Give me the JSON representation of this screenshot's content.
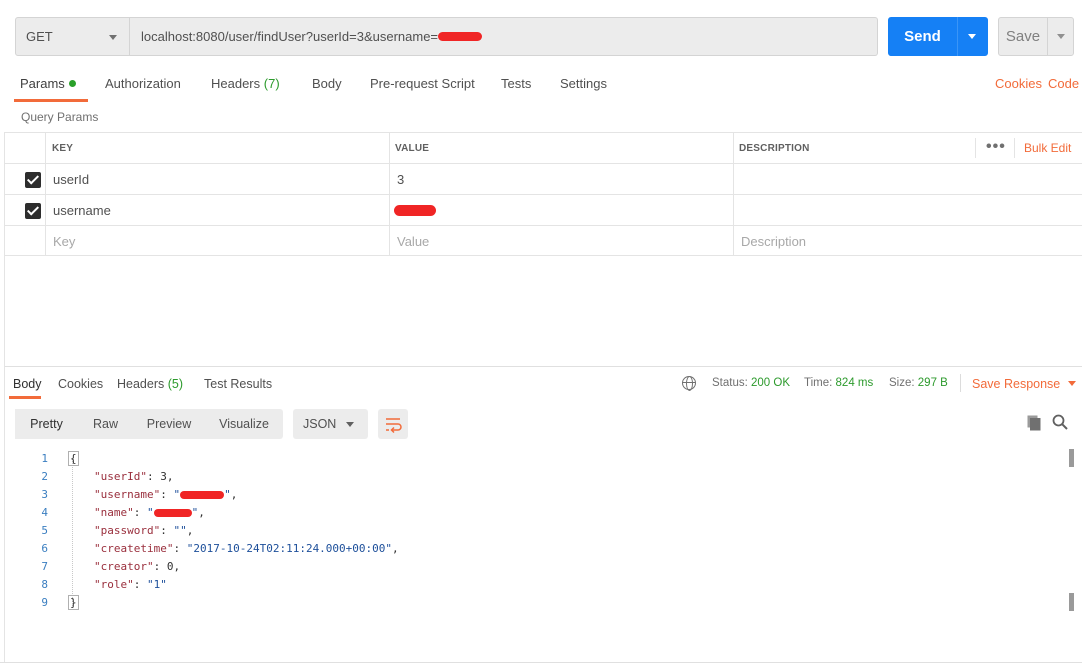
{
  "request": {
    "method": "GET",
    "url": "localhost:8080/user/findUser?userId=3&username=",
    "send_label": "Send",
    "save_label": "Save"
  },
  "tabs": [
    {
      "label": "Params"
    },
    {
      "label": "Authorization"
    },
    {
      "label": "Headers",
      "count": "(7)"
    },
    {
      "label": "Body"
    },
    {
      "label": "Pre-request Script"
    },
    {
      "label": "Tests"
    },
    {
      "label": "Settings"
    }
  ],
  "links": {
    "cookies": "Cookies",
    "code": "Code"
  },
  "query_params": {
    "title": "Query Params",
    "columns": [
      "KEY",
      "VALUE",
      "DESCRIPTION"
    ],
    "more": "•••",
    "bulk_edit": "Bulk Edit",
    "rows": [
      {
        "key": "userId",
        "value": "3",
        "description": "",
        "checked": true
      },
      {
        "key": "username",
        "value": "",
        "description": "",
        "checked": true
      }
    ],
    "placeholders": {
      "key": "Key",
      "value": "Value",
      "description": "Description"
    }
  },
  "response": {
    "tabs": [
      {
        "label": "Body"
      },
      {
        "label": "Cookies"
      },
      {
        "label": "Headers",
        "count": "(5)"
      },
      {
        "label": "Test Results"
      }
    ],
    "status_label": "Status:",
    "status_value": "200 OK",
    "time_label": "Time:",
    "time_value": "824 ms",
    "size_label": "Size:",
    "size_value": "297 B",
    "save_response": "Save Response",
    "views": [
      "Pretty",
      "Raw",
      "Preview",
      "Visualize"
    ],
    "format": "JSON"
  },
  "code_lines": [
    {
      "n": "1",
      "text": "{"
    },
    {
      "n": "2",
      "key": "\"userId\"",
      "val": "3",
      "type": "num",
      "comma": ","
    },
    {
      "n": "3",
      "key": "\"username\"",
      "val": "",
      "type": "redacted",
      "comma": ","
    },
    {
      "n": "4",
      "key": "\"name\"",
      "val": "",
      "type": "redacted",
      "comma": ","
    },
    {
      "n": "5",
      "key": "\"password\"",
      "val": "\"\"",
      "type": "str",
      "comma": ","
    },
    {
      "n": "6",
      "key": "\"createtime\"",
      "val": "\"2017-10-24T02:11:24.000+00:00\"",
      "type": "str",
      "comma": ","
    },
    {
      "n": "7",
      "key": "\"creator\"",
      "val": "0",
      "type": "num",
      "comma": ","
    },
    {
      "n": "8",
      "key": "\"role\"",
      "val": "\"1\"",
      "type": "str",
      "comma": ""
    },
    {
      "n": "9",
      "text": "}"
    }
  ],
  "colors": {
    "accent": "#f26b3a",
    "send": "#1580f5",
    "success": "#2c9a2c"
  }
}
